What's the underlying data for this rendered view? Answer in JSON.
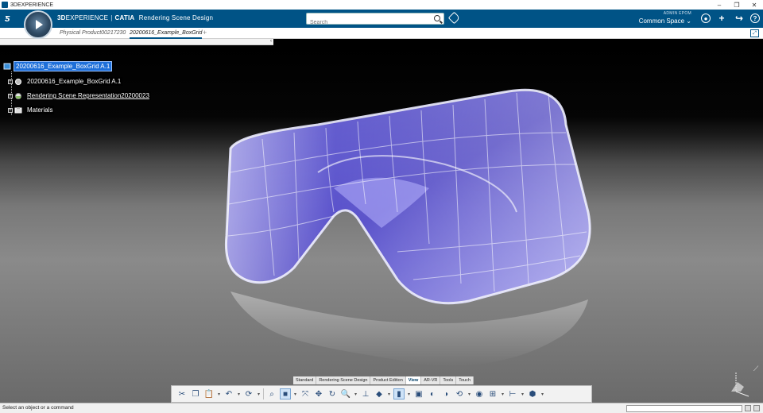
{
  "window": {
    "title": "3DEXPERIENCE",
    "controls": [
      "minimize-icon",
      "restore-icon",
      "close-icon"
    ]
  },
  "topbar": {
    "brand_3d": "3D",
    "brand_experience": "EXPERIENCE",
    "brand_catia": "CATIA",
    "app_name": "Rendering Scene Design",
    "search_placeholder": "Search",
    "user_name": "ADMIN EPOM",
    "collab_space": "Common Space",
    "icons": [
      "user-profile-icon",
      "add-icon",
      "share-icon",
      "help-icon"
    ]
  },
  "tabs": [
    {
      "label": "Physical Product00217230",
      "active": false
    },
    {
      "label": "20200616_Example_BoxGrid",
      "active": true
    }
  ],
  "tab_add": "+",
  "tree": [
    {
      "label": "20200616_Example_BoxGrid A.1",
      "selected": true,
      "icon": "product-icon"
    },
    {
      "label": "20200616_Example_BoxGrid A.1",
      "selected": false,
      "icon": "part-icon"
    },
    {
      "label": "Rendering Scene Representation20200023",
      "selected": false,
      "icon": "scene-icon"
    },
    {
      "label": "Materials",
      "selected": false,
      "icon": "materials-icon"
    }
  ],
  "section_tabs": [
    {
      "label": "Standard",
      "active": false
    },
    {
      "label": "Rendering Scene Design",
      "active": false
    },
    {
      "label": "Product Edition",
      "active": false
    },
    {
      "label": "View",
      "active": true
    },
    {
      "label": "AR-VR",
      "active": false
    },
    {
      "label": "Tools",
      "active": false
    },
    {
      "label": "Touch",
      "active": false
    }
  ],
  "status": {
    "prompt": "Select an object or a command"
  },
  "colors": {
    "brand_blue": "#005386",
    "selection_blue": "#1e6fd9",
    "model_violet": "#4a3fd0"
  }
}
